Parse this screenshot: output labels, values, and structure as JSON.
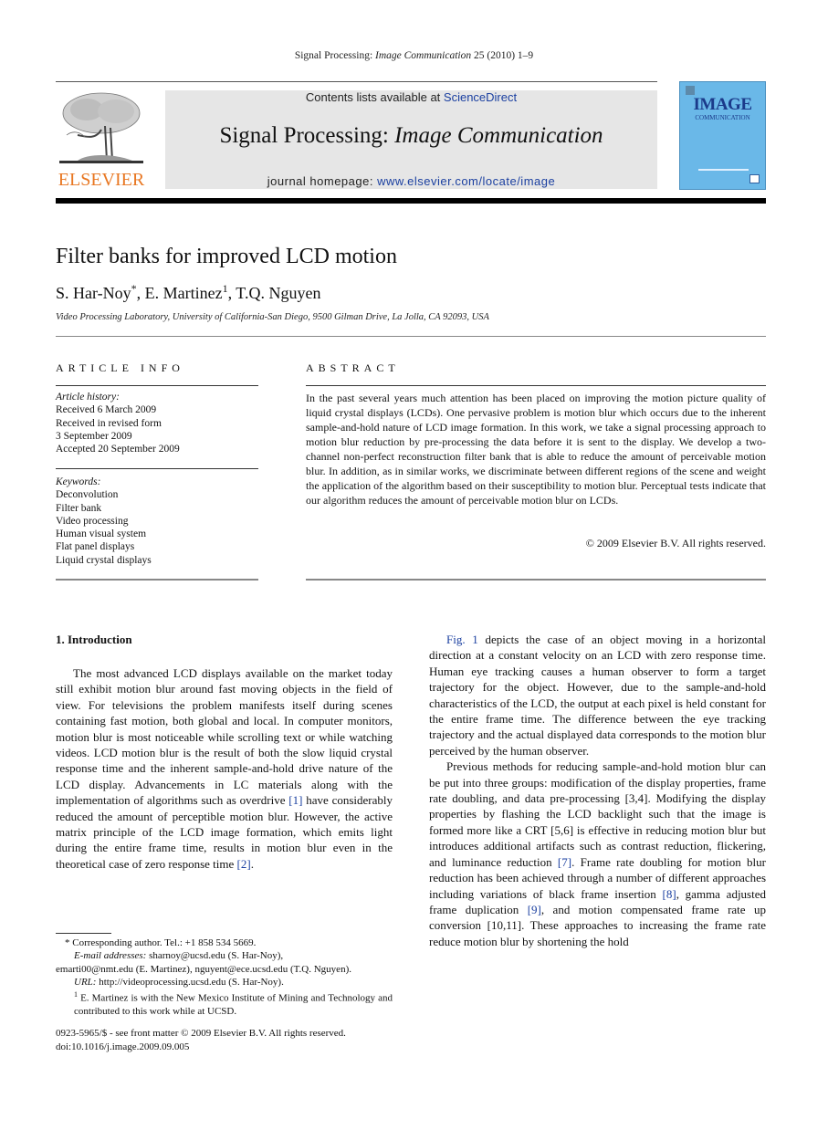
{
  "running_head": {
    "journal_plain": "Signal Processing: ",
    "journal_italic": "Image Communication",
    "volume_info": " 25 (2010) 1–9"
  },
  "publisher_logo": {
    "text": "ELSEVIER",
    "color": "#e87722"
  },
  "banner": {
    "contents_prefix": "Contents lists available at ",
    "contents_link": "ScienceDirect",
    "journal_plain": "Signal Processing: ",
    "journal_italic": "Image Communication",
    "homepage_prefix": "journal homepage: ",
    "homepage_link": "www.elsevier.com/locate/image",
    "background": "#e6e6e6",
    "link_color": "#1a3fa0"
  },
  "cover": {
    "title": "IMAGE",
    "subtitle": "COMMUNICATION",
    "color": "#6ab8e8"
  },
  "article": {
    "title": "Filter banks for improved LCD motion",
    "authors": [
      {
        "name": "S. Har-Noy",
        "mark": "*"
      },
      {
        "name": "E. Martinez",
        "mark": "1"
      },
      {
        "name": "T.Q. Nguyen",
        "mark": ""
      }
    ],
    "affiliation": "Video Processing Laboratory, University of California-San Diego, 9500 Gilman Drive, La Jolla, CA 92093, USA"
  },
  "article_info": {
    "heading": "ARTICLE INFO",
    "history_label": "Article history:",
    "history": [
      "Received 6 March 2009",
      "Received in revised form",
      "3 September 2009",
      "Accepted 20 September 2009"
    ],
    "keywords_label": "Keywords:",
    "keywords": [
      "Deconvolution",
      "Filter bank",
      "Video processing",
      "Human visual system",
      "Flat panel displays",
      "Liquid crystal displays"
    ]
  },
  "abstract": {
    "heading": "ABSTRACT",
    "text": "In the past several years much attention has been placed on improving the motion picture quality of liquid crystal displays (LCDs). One pervasive problem is motion blur which occurs due to the inherent sample-and-hold nature of LCD image formation. In this work, we take a signal processing approach to motion blur reduction by pre-processing the data before it is sent to the display. We develop a two-channel non-perfect reconstruction filter bank that is able to reduce the amount of perceivable motion blur. In addition, as in similar works, we discriminate between different regions of the scene and weight the application of the algorithm based on their susceptibility to motion blur. Perceptual tests indicate that our algorithm reduces the amount of perceivable motion blur on LCDs.",
    "copyright": "© 2009 Elsevier B.V. All rights reserved."
  },
  "introduction": {
    "heading": "1.  Introduction",
    "left_paragraph": {
      "part1": "The most advanced LCD displays available on the market today still exhibit motion blur around fast moving objects in the field of view. For televisions the problem manifests itself during scenes containing fast motion, both global and local. In computer monitors, motion blur is most noticeable while scrolling text or while watching videos. LCD motion blur is the result of both the slow liquid crystal response time and the inherent sample-and-hold drive nature of the LCD display. Advancements in LC materials along with the implementation of algorithms such as overdrive ",
      "cite1": "[1]",
      "part2": " have considerably reduced the amount of perceptible motion blur. However, the active matrix principle of the LCD image formation, which emits light during the entire frame time, results in motion blur even in the theoretical case of zero response time ",
      "cite2": "[2]",
      "part3": "."
    },
    "right_paragraph1": {
      "cite": "Fig. 1",
      "text": " depicts the case of an object moving in a horizontal direction at a constant velocity on an LCD with zero response time. Human eye tracking causes a human observer to form a target trajectory for the object. However, due to the sample-and-hold characteristics of the LCD, the output at each pixel is held constant for the entire frame time. The difference between the eye tracking trajectory and the actual displayed data corresponds to the motion blur perceived by the human observer."
    },
    "right_paragraph2": {
      "part1": "Previous methods for reducing sample-and-hold motion blur can be put into three groups: modification of the display properties, frame rate doubling, and data pre-processing [3,4]. Modifying the display properties by flashing the LCD backlight such that the image is formed more like a CRT [5,6] is effective in reducing motion blur but introduces additional artifacts such as contrast reduction, flickering, and luminance reduction ",
      "cite7": "[7]",
      "part2": ". Frame rate doubling for motion blur reduction has been achieved through a number of different approaches including variations of black frame insertion ",
      "cite8": "[8]",
      "part3": ", gamma adjusted frame duplication ",
      "cite9": "[9]",
      "part4": ", and motion compensated frame rate up conversion [10,11]. These approaches to increasing the frame rate reduce motion blur by shortening the hold"
    }
  },
  "footnotes": {
    "corresponding": "* Corresponding author. Tel.: +1 858 534 5669.",
    "email_label": "E-mail addresses:",
    "email_line1": " sharnoy@ucsd.edu (S. Har-Noy),",
    "email_line2": "emarti00@nmt.edu (E. Martinez), nguyent@ece.ucsd.edu (T.Q. Nguyen).",
    "url_label": "URL:",
    "url_text": " http://videoprocessing.ucsd.edu (S. Har-Noy).",
    "note1_mark": "1",
    "note1_text": " E. Martinez is with the New Mexico Institute of Mining and Technology and contributed to this work while at UCSD."
  },
  "front_matter": {
    "issn_line": "0923-5965/$ - see front matter © 2009 Elsevier B.V. All rights reserved.",
    "doi": "doi:10.1016/j.image.2009.09.005"
  }
}
